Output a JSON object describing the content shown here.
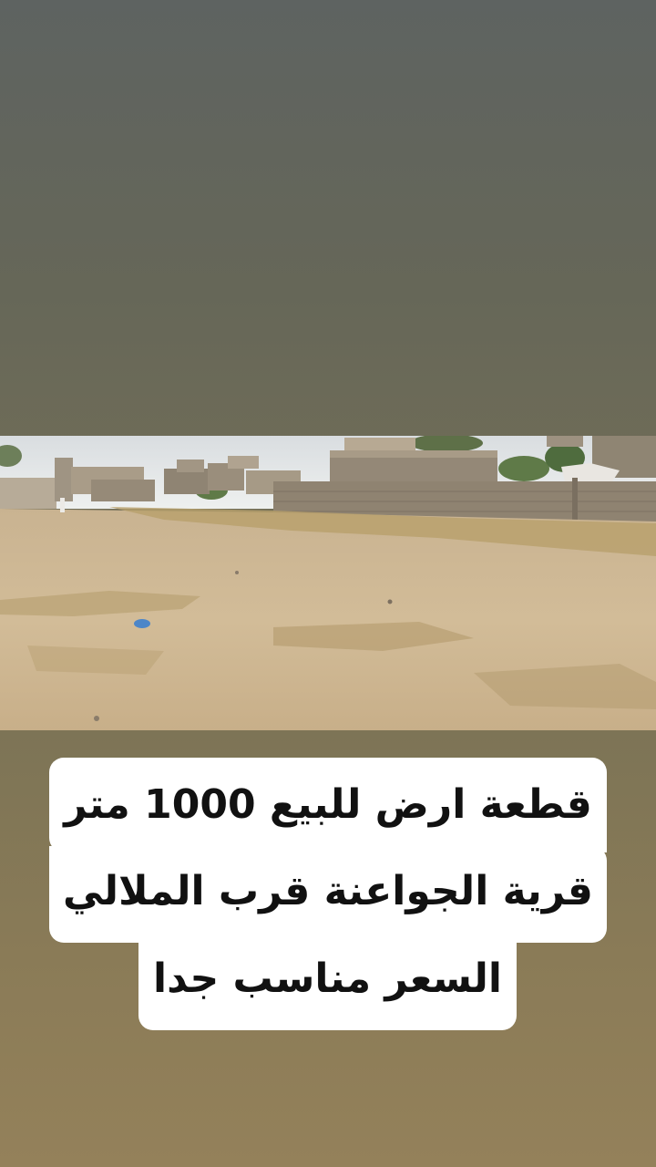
{
  "photo": {
    "description_icon": "land-plot-photo"
  },
  "caption": {
    "line1": "قطعة ارض للبيع 1000 متر",
    "line2": "قرية الجواعنة قرب الملالي",
    "line3": "السعر مناسب جدا"
  },
  "colors": {
    "background_top": "#5e6361",
    "background_bottom": "#94815a",
    "caption_bg": "#ffffff",
    "caption_text": "#111111"
  }
}
